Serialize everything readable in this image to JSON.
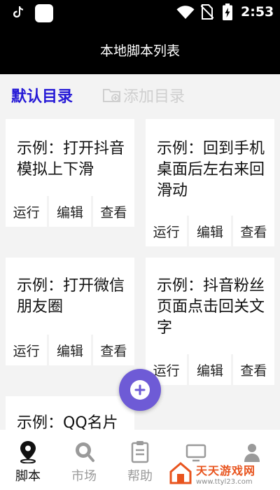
{
  "statusbar": {
    "time": "2:53",
    "icons": [
      "tiktok-icon",
      "app-square-icon",
      "wifi-icon",
      "no-sim-icon",
      "battery-charging-icon"
    ]
  },
  "appbar": {
    "title": "本地脚本列表"
  },
  "directory": {
    "default_label": "默认目录",
    "add_label": "添加目录",
    "add_icon": "folder-add-icon",
    "accent": "#2418d6"
  },
  "scripts": [
    {
      "title": "示例：打开抖音模拟上下滑",
      "actions": [
        "运行",
        "编辑",
        "查看"
      ]
    },
    {
      "title": "示例：回到手机桌面后左右来回滑动",
      "actions": [
        "运行",
        "编辑",
        "查看"
      ]
    },
    {
      "title": "示例：打开微信朋友圈",
      "actions": [
        "运行",
        "编辑",
        "查看"
      ]
    },
    {
      "title": "示例：抖音粉丝页面点击回关文字",
      "actions": [
        "运行",
        "编辑",
        "查看"
      ]
    },
    {
      "title": "示例：QQ名片"
    }
  ],
  "fab": {
    "icon": "plus-icon",
    "color": "#6e5bd6"
  },
  "bottom_nav": [
    {
      "label": "脚本",
      "icon": "location-pin-icon",
      "active": true
    },
    {
      "label": "市场",
      "icon": "search-icon",
      "active": false
    },
    {
      "label": "帮助",
      "icon": "clipboard-icon",
      "active": false
    },
    {
      "label": "",
      "icon": "monitor-icon",
      "active": false
    },
    {
      "label": "",
      "icon": "user-icon",
      "active": false
    }
  ],
  "watermark": {
    "name": "天天游戏网",
    "url": "www.ttyl23.com"
  }
}
